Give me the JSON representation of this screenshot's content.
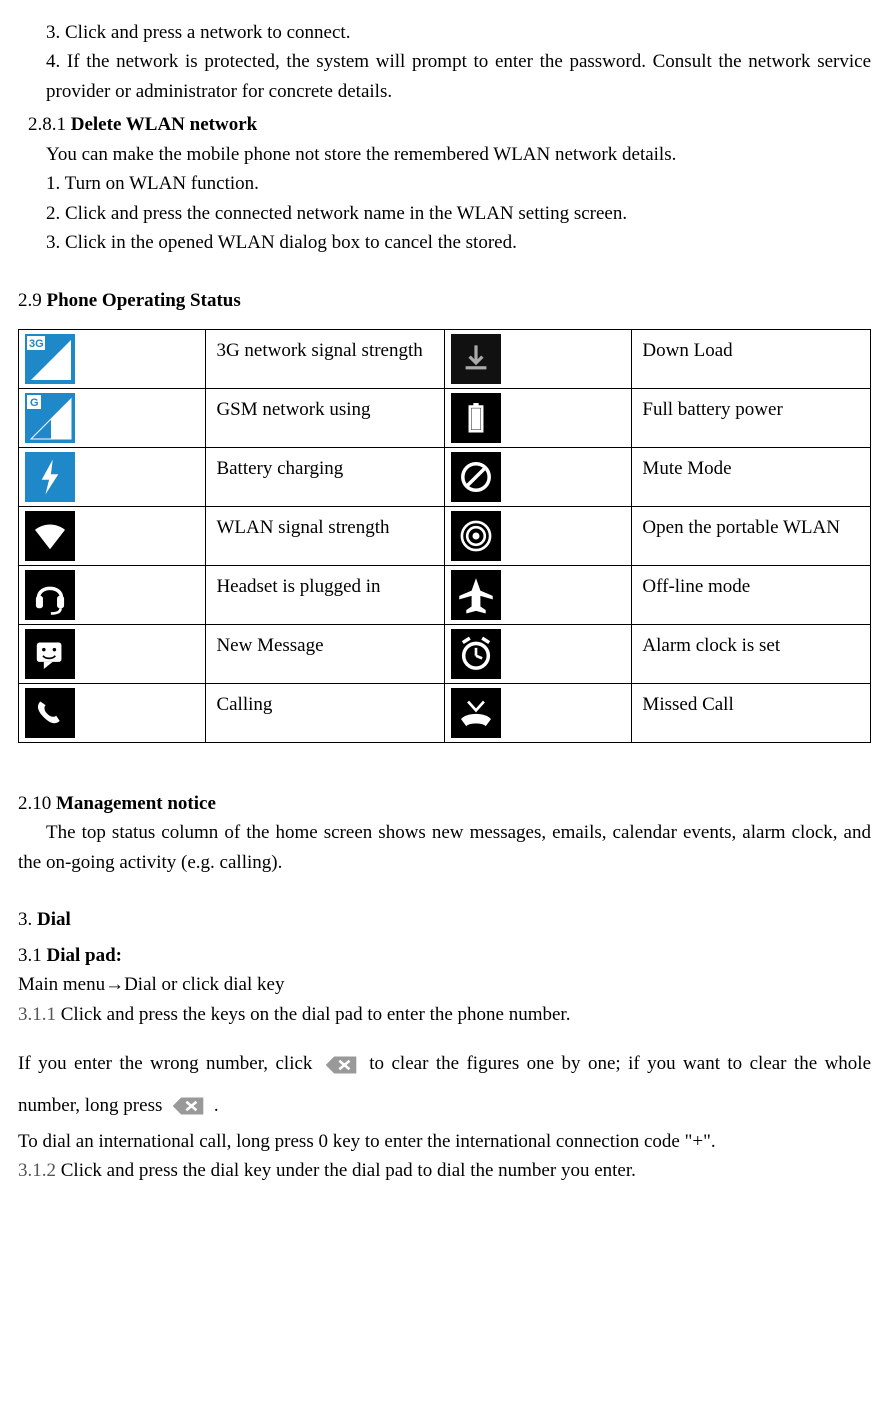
{
  "intro": {
    "step3": "3. Click and press a network to connect.",
    "step4": "4. If the network is protected, the system will prompt to enter the password. Consult the network service provider or administrator for concrete details."
  },
  "section_281_num": "2.8.1",
  "section_281_title": "Delete WLAN network",
  "section_281_lead": "You can make the mobile phone not store the remembered WLAN network details.",
  "section_281_step1": "1. Turn on WLAN function.",
  "section_281_step2": "2. Click and press the connected network name in the WLAN setting screen.",
  "section_281_step3": "3. Click in the opened WLAN dialog box to cancel the stored.",
  "section_29_num": "2.9",
  "section_29_title": "Phone Operating Status",
  "status_table": [
    {
      "left": "3G network signal strength",
      "right": "Down Load"
    },
    {
      "left": "GSM network using",
      "right": "Full battery power"
    },
    {
      "left": "Battery charging",
      "right": "Mute Mode"
    },
    {
      "left": "WLAN signal strength",
      "right": "Open the portable WLAN"
    },
    {
      "left": "Headset is plugged in",
      "right": "Off-line mode"
    },
    {
      "left": "New Message",
      "right": "Alarm clock is set"
    },
    {
      "left": "Calling",
      "right": "Missed Call"
    }
  ],
  "section_210_num": "2.10",
  "section_210_title": "Management notice",
  "section_210_body": "The top status column of the home screen shows new messages, emails, calendar events, alarm clock, and the on-going activity (e.g. calling).",
  "section_3_num": "3.",
  "section_3_title": "Dial",
  "section_31_num": "3.1",
  "section_31_title": "Dial pad:",
  "section_31_lead": "Main menu→Dial or click dial key",
  "section_311_num": "3.1.1",
  "section_311_body": "Click and press the keys on the dial pad to enter the phone number.",
  "wrong_num_a": "If you enter the wrong number, click ",
  "wrong_num_b": " to clear the figures one by one; if you want to clear the whole number, long press ",
  "wrong_num_c": ".",
  "intl_line": "To dial an international call, long press 0 key to enter the international connection code \"+\".",
  "section_312_num": "3.1.2",
  "section_312_body": "Click and press the dial key under the dial pad to dial the number you enter."
}
